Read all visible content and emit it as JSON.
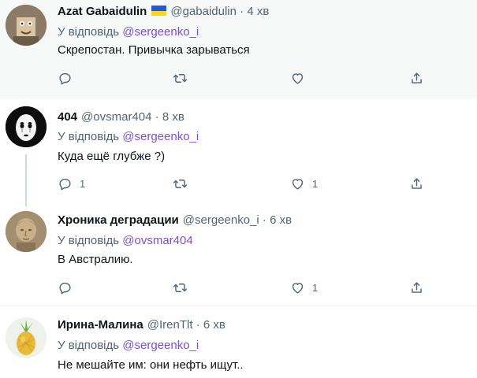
{
  "tweets": [
    {
      "name": "Azat Gabaidulin",
      "has_flag": true,
      "handle": "@gabaidulin",
      "separator": "·",
      "time": "4 хв",
      "reply_prefix": "У відповідь",
      "reply_to": "@sergeenko_i",
      "text": "Скрепостан. Привычка зарываться",
      "reply_count": "",
      "like_count": ""
    },
    {
      "name": "404",
      "handle": "@ovsmar404",
      "separator": "·",
      "time": "8 хв",
      "reply_prefix": "У відповідь",
      "reply_to": "@sergeenko_i",
      "text": "Куда ещё глубже ?)",
      "reply_count": "1",
      "like_count": "1"
    },
    {
      "name": "Хроника деградации",
      "handle": "@sergeenko_i",
      "separator": "·",
      "time": "6 хв",
      "reply_prefix": "У відповідь",
      "reply_to": "@ovsmar404",
      "text": "В Австралию.",
      "reply_count": "",
      "like_count": "1"
    },
    {
      "name": "Ирина-Малина",
      "handle": "@IrenTlt",
      "separator": "·",
      "time": "6 хв",
      "reply_prefix": "У відповідь",
      "reply_to": "@sergeenko_i",
      "text": "Не мешайте им: они нефть ищут.."
    }
  ],
  "colors": {
    "text": "#0f1419",
    "secondary": "#536471",
    "mention": "#7b51c9",
    "highlight_bg": "#f7f9f9"
  },
  "icons": [
    "reply-icon",
    "retweet-icon",
    "like-icon",
    "share-icon"
  ]
}
